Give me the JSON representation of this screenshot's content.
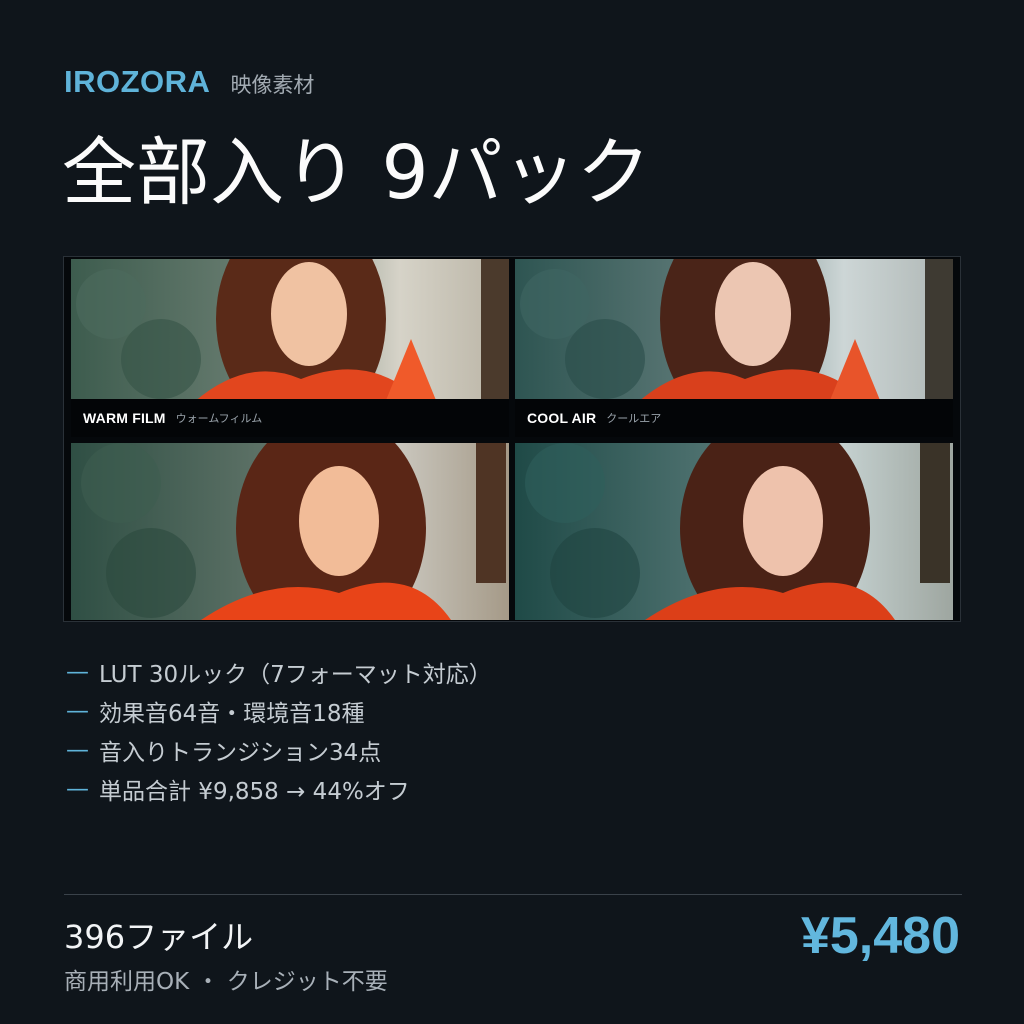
{
  "header": {
    "brand": "IROZORA",
    "brand_sub": "映像素材"
  },
  "title": "全部入り 9パック",
  "gallery": {
    "tiles": [
      {
        "label_en": "WARM FILM",
        "label_ja": "ウォームフィルム",
        "tone": "warm"
      },
      {
        "label_en": "COOL AIR",
        "label_ja": "クールエア",
        "tone": "cool"
      },
      {
        "label_en": "",
        "label_ja": "",
        "tone": "neutral"
      },
      {
        "label_en": "",
        "label_ja": "",
        "tone": "teal"
      }
    ]
  },
  "features": {
    "bullet": "—",
    "items": [
      "LUT 30ルック（7フォーマット対応）",
      "効果音64音・環境音18種",
      "音入りトランジション34点",
      "単品合計 ¥9,858 → 44%オフ"
    ]
  },
  "footer": {
    "file_count": "396ファイル",
    "license": "商用利用OK ・ クレジット不要",
    "price": "¥5,480"
  },
  "colors": {
    "background": "#0f151b",
    "accent": "#5fb3d9",
    "jacket": "#e2461e"
  }
}
